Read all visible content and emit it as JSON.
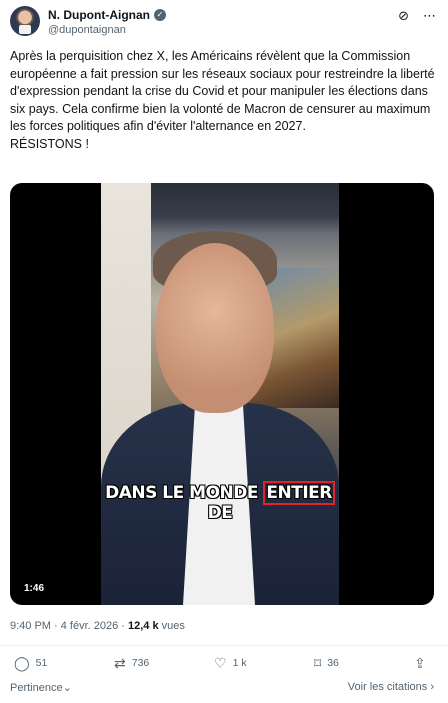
{
  "author": {
    "name": "N. Dupont-Aignan",
    "handle": "@dupontaignan"
  },
  "icons": {
    "verified": "verified-badge-icon",
    "grok": "grok-icon",
    "more": "more-icon",
    "reply": "reply-icon",
    "retweet": "retweet-icon",
    "like": "heart-icon",
    "bookmark": "bookmark-icon",
    "share": "share-icon"
  },
  "tweet": {
    "text": "Après la perquisition chez X, les Américains révèlent que la Commission européenne a fait pression sur les réseaux sociaux pour restreindre la liberté d'expression pendant la crise du Covid et pour manipuler les élections dans six pays. Cela confirme bien la volonté de Macron de censurer au maximum les forces politiques afin d'éviter l'alternance en 2027.\nRÉSISTONS !"
  },
  "video": {
    "caption_before": "DANS LE MONDE ",
    "caption_highlight": "ENTIER",
    "caption_after": " DE",
    "duration": "1:46"
  },
  "meta": {
    "time_date": "9:40 PM · 4 févr. 2026 · ",
    "views_count": "12,4 k",
    "views_label": " vues"
  },
  "actions": {
    "replies": "51",
    "retweets": "736",
    "likes": "1 k",
    "bookmarks": "36"
  },
  "footer": {
    "sort_label": "Pertinence",
    "sort_chevron": "⌄",
    "quotes_label": "Voir les citations ›"
  },
  "colors": {
    "text": "#0f1419",
    "muted": "#536471",
    "caption_box": "#e0242a"
  }
}
